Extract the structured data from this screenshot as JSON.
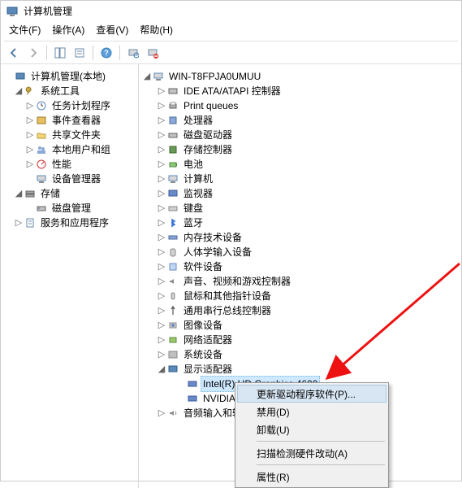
{
  "window": {
    "title": "计算机管理"
  },
  "menubar": {
    "file": "文件(F)",
    "action": "操作(A)",
    "view": "查看(V)",
    "help": "帮助(H)"
  },
  "leftTree": {
    "root": "计算机管理(本地)",
    "sysTools": "系统工具",
    "taskScheduler": "任务计划程序",
    "eventViewer": "事件查看器",
    "sharedFolders": "共享文件夹",
    "localUsers": "本地用户和组",
    "performance": "性能",
    "deviceManager": "设备管理器",
    "storage": "存储",
    "diskMgmt": "磁盘管理",
    "services": "服务和应用程序"
  },
  "rightTree": {
    "root": "WIN-T8FPJA0UMUU",
    "ide": "IDE ATA/ATAPI 控制器",
    "printQueues": "Print queues",
    "processors": "处理器",
    "diskDrives": "磁盘驱动器",
    "storageControllers": "存储控制器",
    "batteries": "电池",
    "computer": "计算机",
    "monitors": "监视器",
    "keyboards": "键盘",
    "bluetooth": "蓝牙",
    "memoryTech": "内存技术设备",
    "hid": "人体学输入设备",
    "softwareDevices": "软件设备",
    "sound": "声音、视频和游戏控制器",
    "mice": "鼠标和其他指针设备",
    "usb": "通用串行总线控制器",
    "imaging": "图像设备",
    "network": "网络适配器",
    "system": "系统设备",
    "display": "显示适配器",
    "intel": "Intel(R) HD Graphics 4600",
    "nvidia": "NVIDIA",
    "audioIO": "音频输入和输出"
  },
  "contextMenu": {
    "updateDriver": "更新驱动程序软件(P)...",
    "disable": "禁用(D)",
    "uninstall": "卸载(U)",
    "scanHardware": "扫描检测硬件改动(A)",
    "properties": "属性(R)"
  }
}
